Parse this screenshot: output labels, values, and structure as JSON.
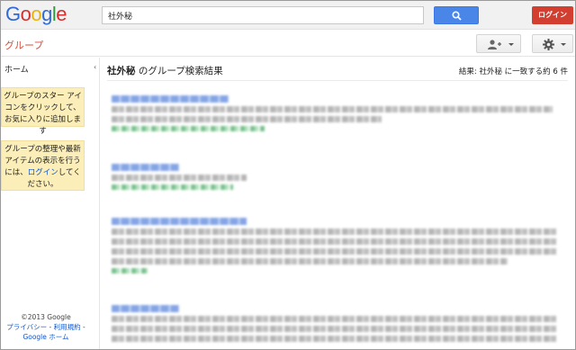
{
  "logo": [
    "G",
    "o",
    "o",
    "g",
    "l",
    "e"
  ],
  "search": {
    "value": "社外秘"
  },
  "header": {
    "login_label": "ログイン"
  },
  "subbar": {
    "brand": "グループ"
  },
  "sidebar": {
    "home": "ホーム",
    "collapse": "‹",
    "note1": "グループのスター アイコンをクリックして、お気に入りに追加します",
    "note2_pre": "グループの整理や最新アイテムの表示を行うには、",
    "note2_link": "ログイン",
    "note2_post": "してください。",
    "footer_copyright": "©2013 Google",
    "footer_privacy": "プライバシー",
    "footer_sep": " - ",
    "footer_terms": "利用規約",
    "footer_home": "Google ホーム"
  },
  "main": {
    "query": "社外秘",
    "title_suffix": " のグループ検索結果",
    "count": "結果: 社外秘 に一致する約 6 件"
  },
  "colors": {
    "accent": "#4a86e8",
    "login": "#d23f31",
    "brand": "#dd4b39",
    "note_bg": "#fbeeb8",
    "link": "#1155cc"
  }
}
